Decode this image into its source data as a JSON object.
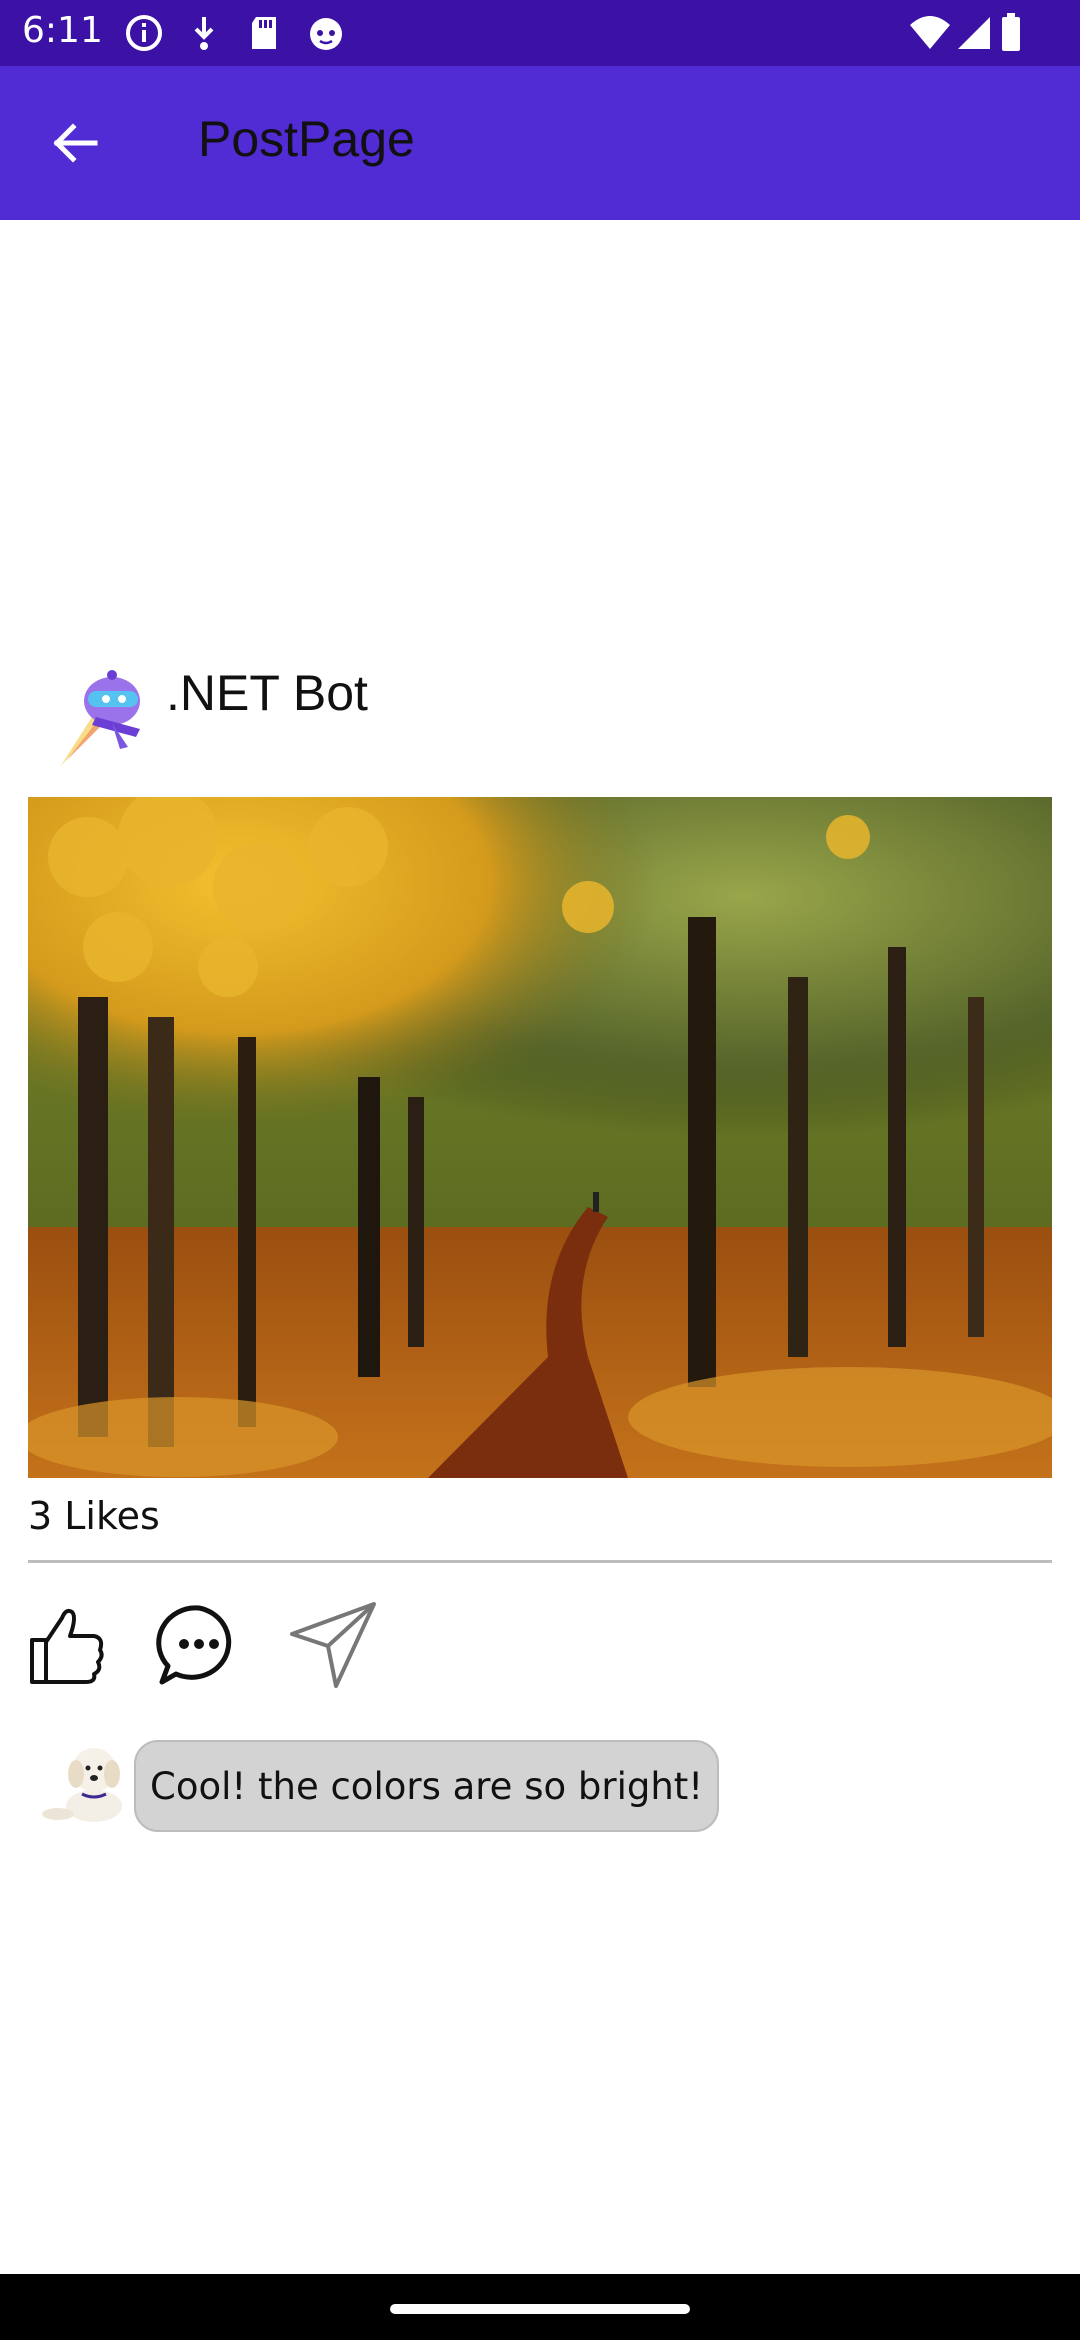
{
  "status_bar": {
    "time": "6:11",
    "left_icons": [
      "info-icon",
      "download-icon",
      "sd-card-icon",
      "cat-icon"
    ],
    "right_icons": [
      "wifi-icon",
      "signal-icon",
      "battery-icon"
    ]
  },
  "app_bar": {
    "title": "PostPage",
    "back_icon": "arrow-left-icon",
    "background_color": "#512bd4"
  },
  "post": {
    "author_name": ".NET Bot",
    "author_avatar": "dotnet-bot-avatar",
    "image": "autumn-forest-path-photo",
    "likes": "3 Likes"
  },
  "actions": {
    "like_icon": "thumbs-up-icon",
    "comment_icon": "comment-bubble-icon",
    "share_icon": "send-icon"
  },
  "comments": [
    {
      "avatar": "puppy-avatar",
      "text": "Cool! the colors are so bright!"
    }
  ]
}
